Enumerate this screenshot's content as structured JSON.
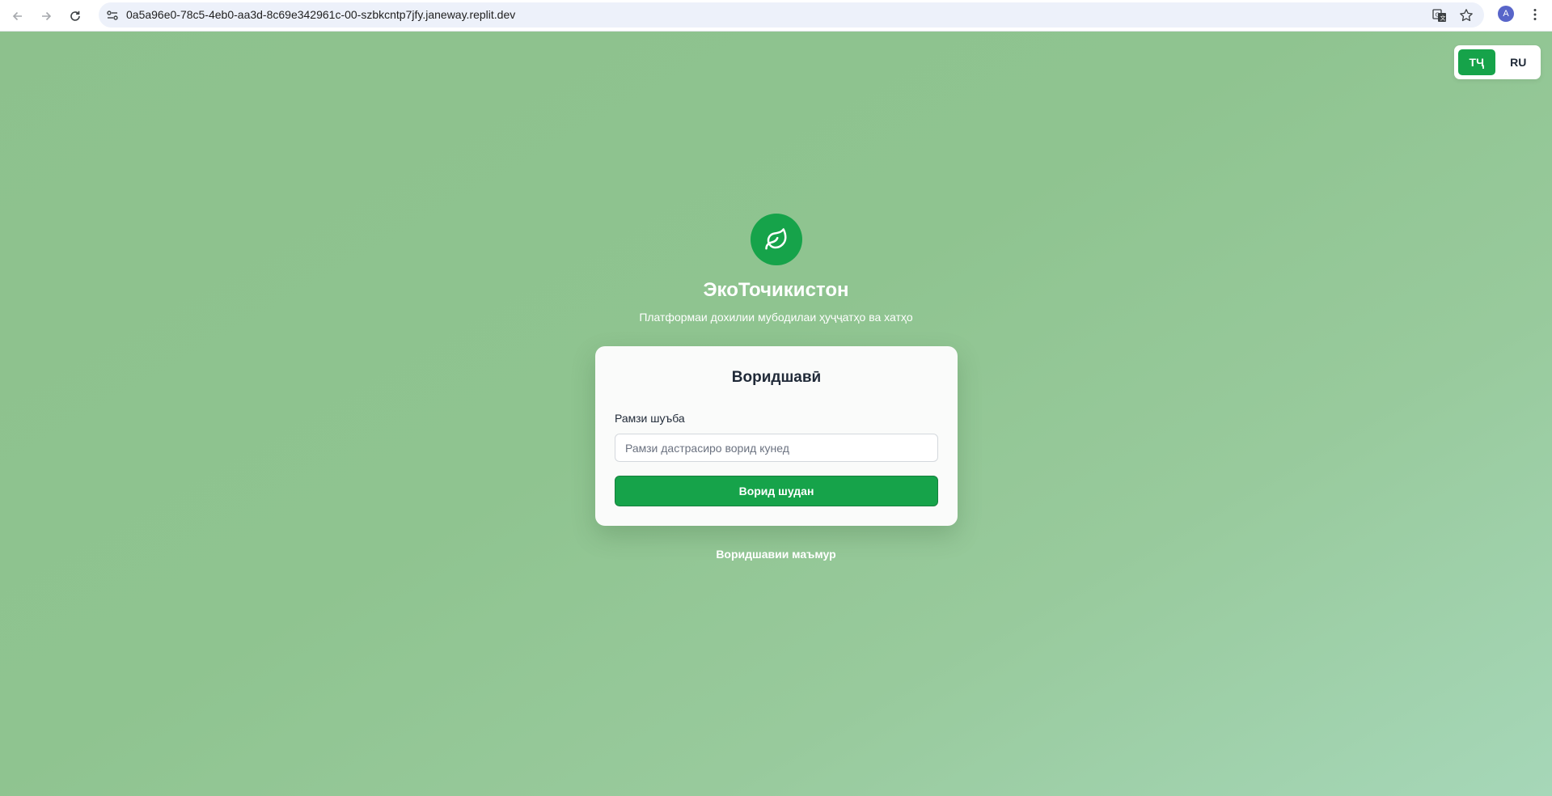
{
  "browser": {
    "url": "0a5a96e0-78c5-4eb0-aa3d-8c69e342961c-00-szbkcntp7jfy.janeway.replit.dev",
    "avatar_letter": "A",
    "icons": [
      "back-arrow-icon",
      "forward-arrow-icon",
      "reload-icon",
      "site-info-icon",
      "translate-icon",
      "bookmark-star-icon",
      "kebab-menu-icon"
    ]
  },
  "lang_switch": {
    "options": [
      {
        "label": "ТҶ",
        "active": true
      },
      {
        "label": "RU",
        "active": false
      }
    ]
  },
  "brand": {
    "logo_icon": "leaf-icon",
    "title": "ЭкоТочикистон",
    "subtitle": "Платформаи дохилии мубодилаи ҳуҷҷатҳо ва хатҳо"
  },
  "login_card": {
    "title": "Воридшавӣ",
    "code_label": "Рамзи шуъба",
    "code_placeholder": "Рамзи дастрасиро ворид кунед",
    "code_value": "",
    "submit_label": "Ворид шудан"
  },
  "admin_link": "Воридшавии маъмур",
  "colors": {
    "accent": "#16a34a",
    "background_start": "#8dc18d",
    "background_end": "#a6d7b8",
    "card": "#fafbfa"
  }
}
